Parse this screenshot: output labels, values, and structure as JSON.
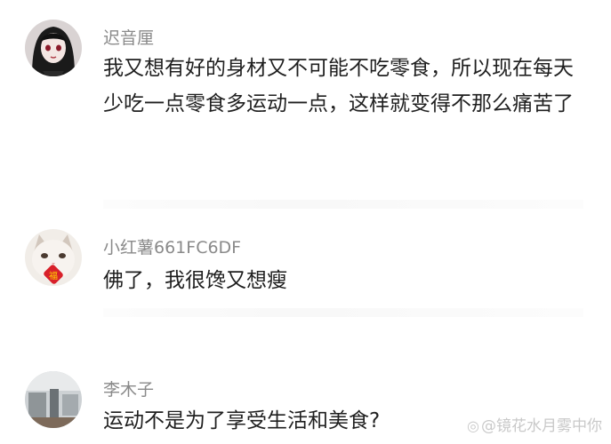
{
  "comments": [
    {
      "author": "迟音厘",
      "avatar": "anime-girl-avatar",
      "text": "我又想有好的身材又不可能不吃零食，所以现在每天少吃一点零食多运动一点，这样就变得不那么痛苦了"
    },
    {
      "author": "小红薯661FC6DF",
      "avatar": "kitten-avatar",
      "text": "佛了，我很馋又想瘦"
    },
    {
      "author": "李木子",
      "avatar": "gym-photo-avatar",
      "text": "运动不是为了享受生活和美食?"
    }
  ],
  "watermark": {
    "icon": "weibo-icon",
    "text": "@镜花水月雾中你"
  }
}
